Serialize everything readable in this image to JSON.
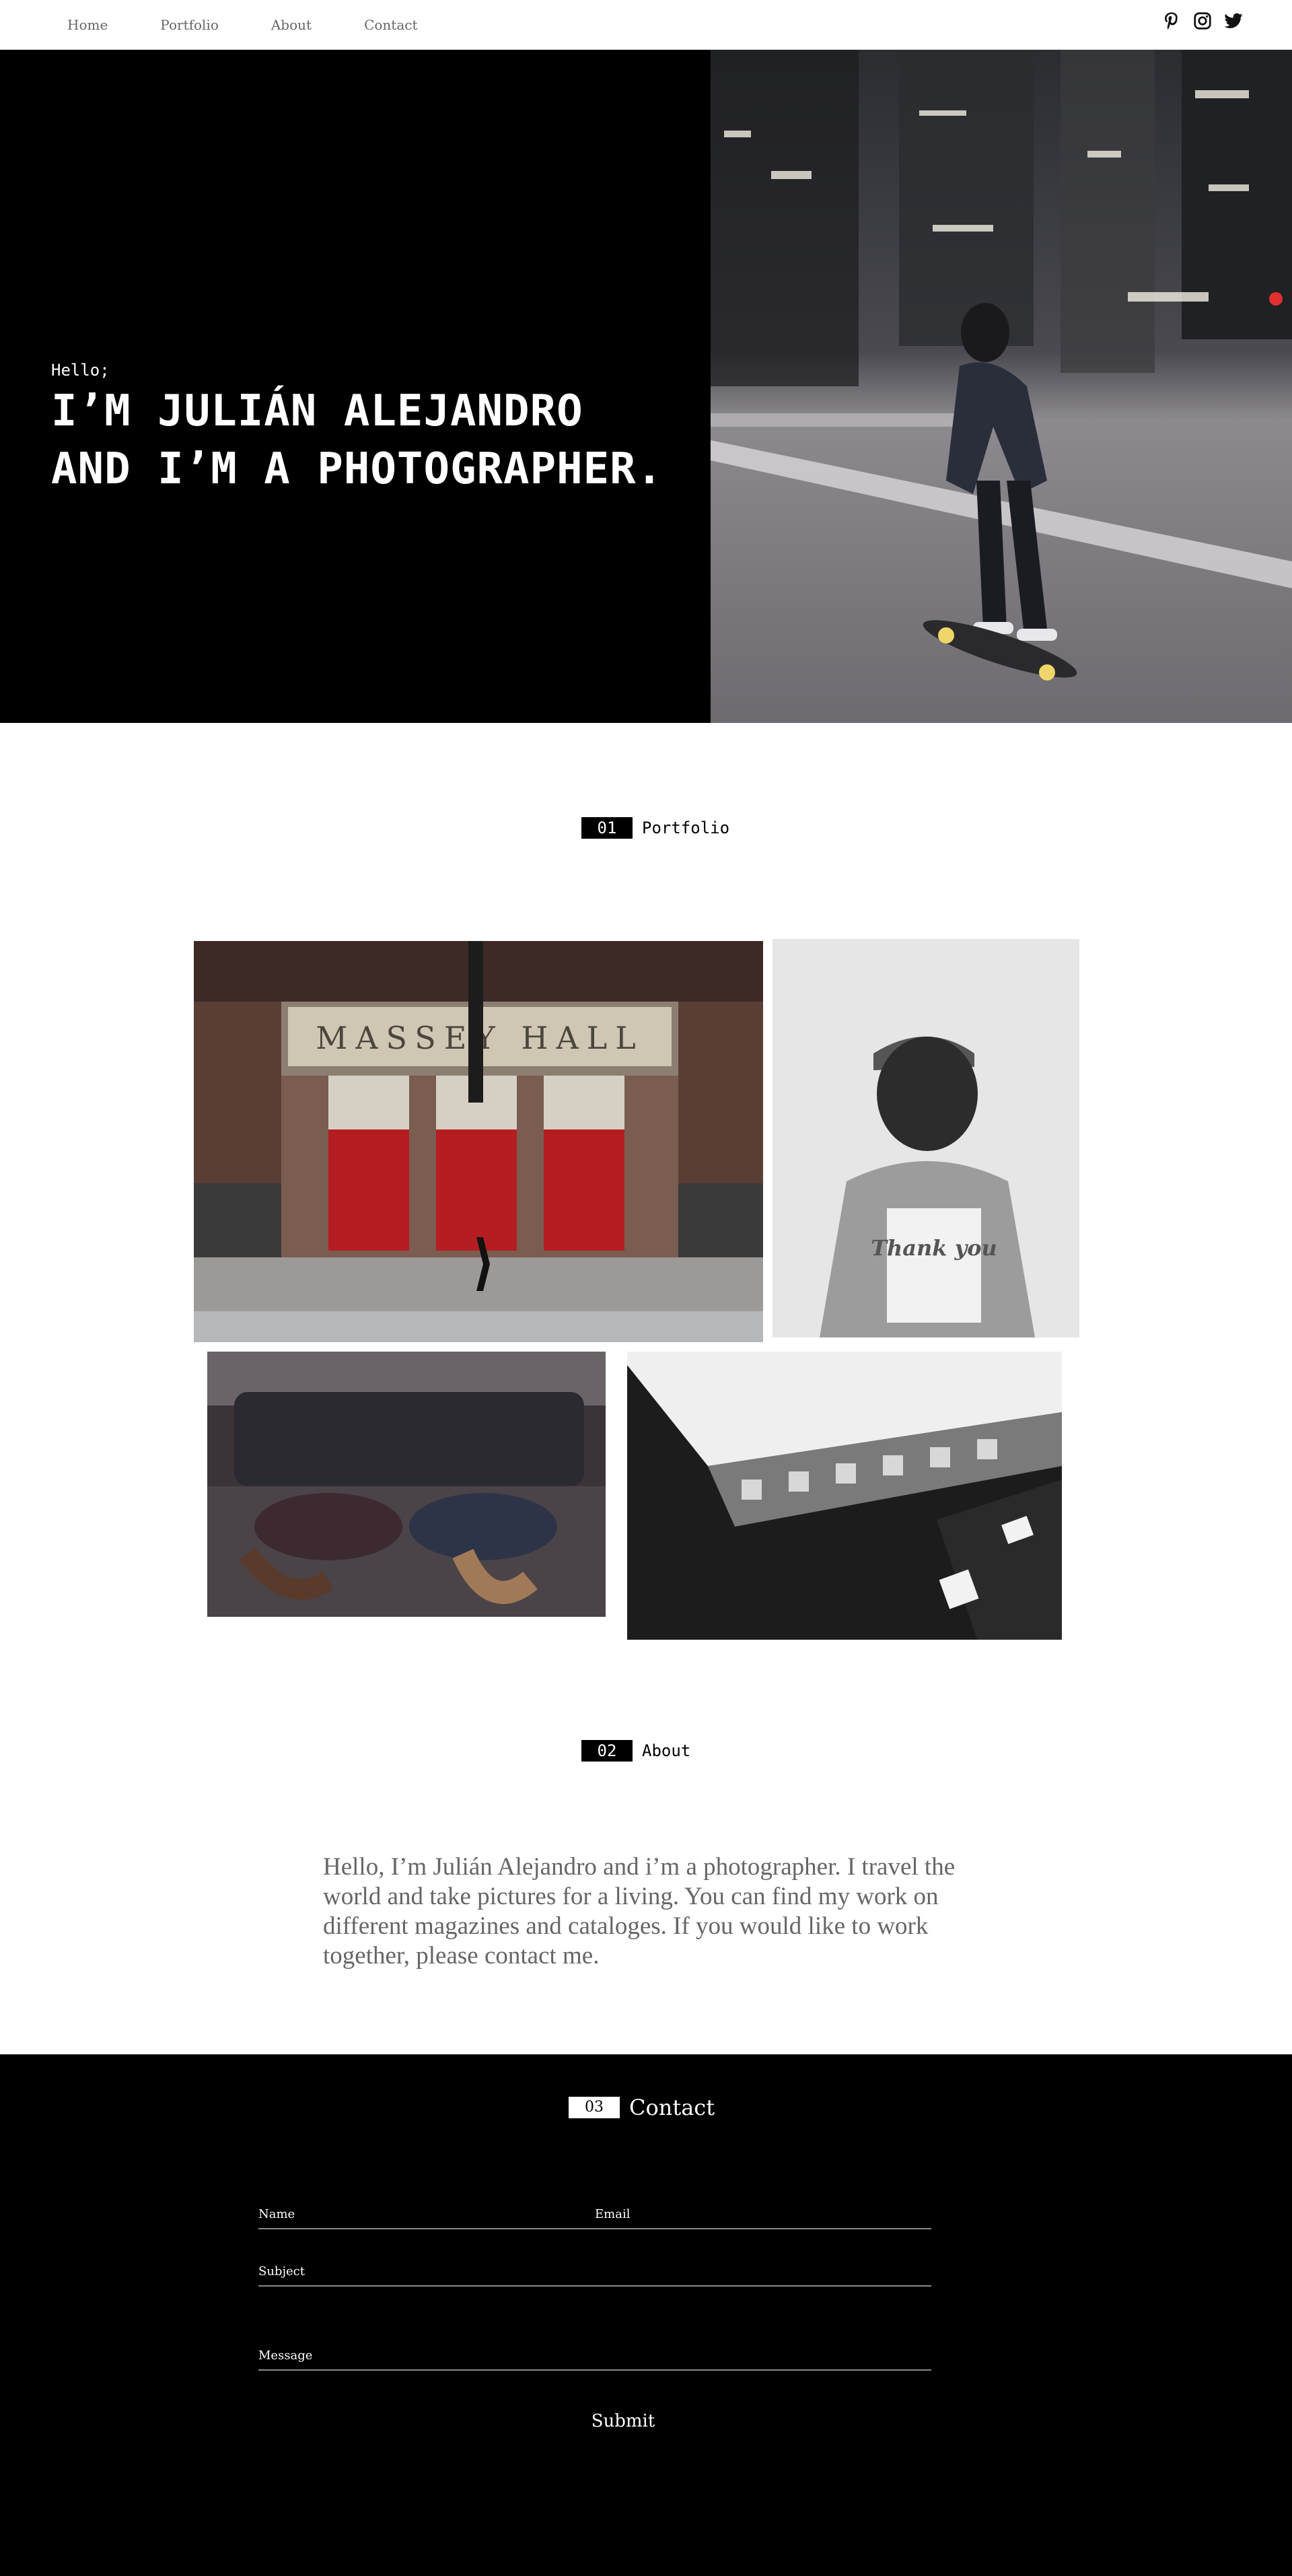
{
  "nav": {
    "links": [
      "Home",
      "Portfolio",
      "About",
      "Contact"
    ],
    "socials": [
      "pinterest-icon",
      "instagram-icon",
      "twitter-icon"
    ]
  },
  "hero": {
    "greeting": "Hello;",
    "title_line1": "I’M JULIÁN ALEJANDRO",
    "title_line2": "AND I’M A PHOTOGRAPHER."
  },
  "portfolio": {
    "number": "01",
    "label": "Portfolio",
    "photos": [
      {
        "caption": "MASSEY HALL"
      },
      {
        "caption": "Thank you"
      }
    ]
  },
  "about": {
    "number": "02",
    "label": "About",
    "text": "Hello, I’m Julián Alejandro and i’m a photographer. I travel the world and take pictures for a living. You can find my work on different magazines and cataloges. If you would like to work together, please contact me."
  },
  "contact": {
    "number": "03",
    "label": "Contact",
    "fields": {
      "name": "Name",
      "email": "Email",
      "subject": "Subject",
      "message": "Message"
    },
    "submit": "Submit"
  },
  "colors": {
    "background": "#ffffff",
    "dark": "#000000",
    "body_text": "#666666"
  }
}
